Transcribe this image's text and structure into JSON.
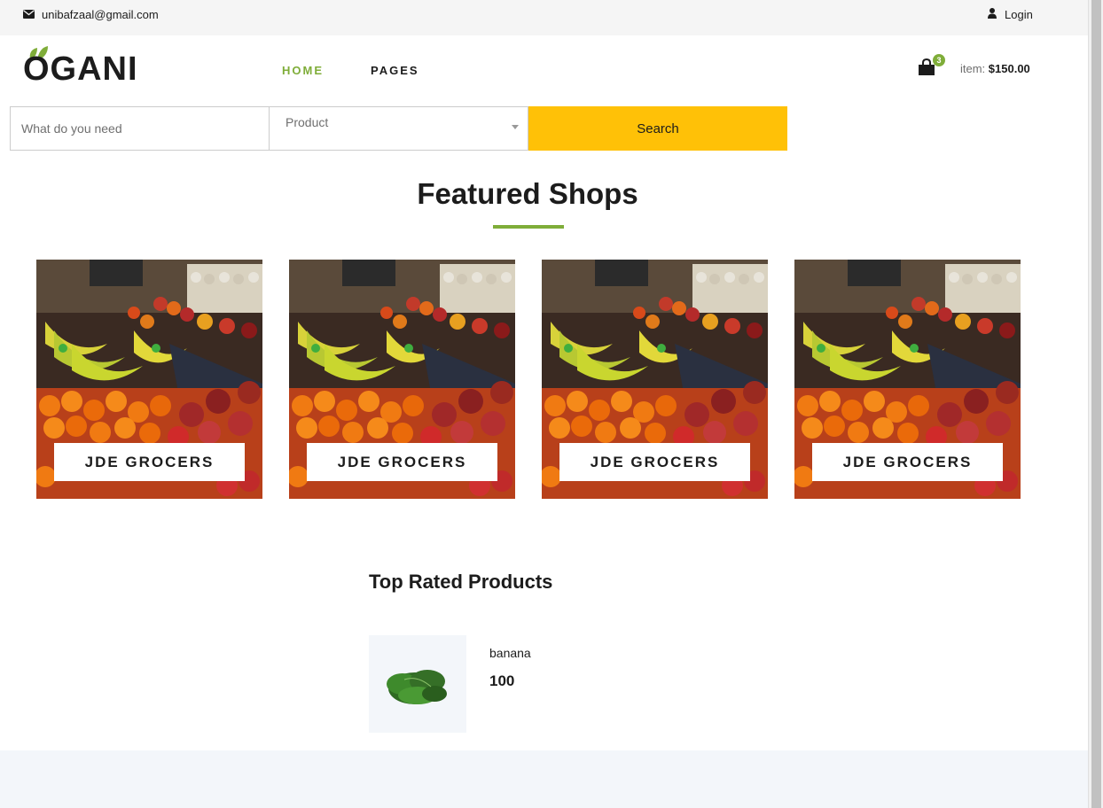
{
  "topbar": {
    "email": "unibafzaal@gmail.com",
    "login": "Login"
  },
  "header": {
    "logo": "OGANI",
    "nav": [
      {
        "label": "HOME"
      },
      {
        "label": "PAGES"
      }
    ],
    "cart_count": "3",
    "item_label": "item:",
    "item_total": "$150.00"
  },
  "search": {
    "placeholder": "What do you need",
    "select_value": "Product",
    "button": "Search"
  },
  "featured": {
    "title": "Featured Shops",
    "shops": [
      {
        "name": "JDE GROCERS"
      },
      {
        "name": "JDE GROCERS"
      },
      {
        "name": "JDE GROCERS"
      },
      {
        "name": "JDE GROCERS"
      }
    ]
  },
  "top_rated": {
    "title": "Top Rated Products",
    "products": [
      {
        "name": "banana",
        "price": "100"
      }
    ]
  },
  "colors": {
    "accent": "#7fad39",
    "search_button": "#ffc107",
    "footer_bg": "#f3f6fa"
  }
}
